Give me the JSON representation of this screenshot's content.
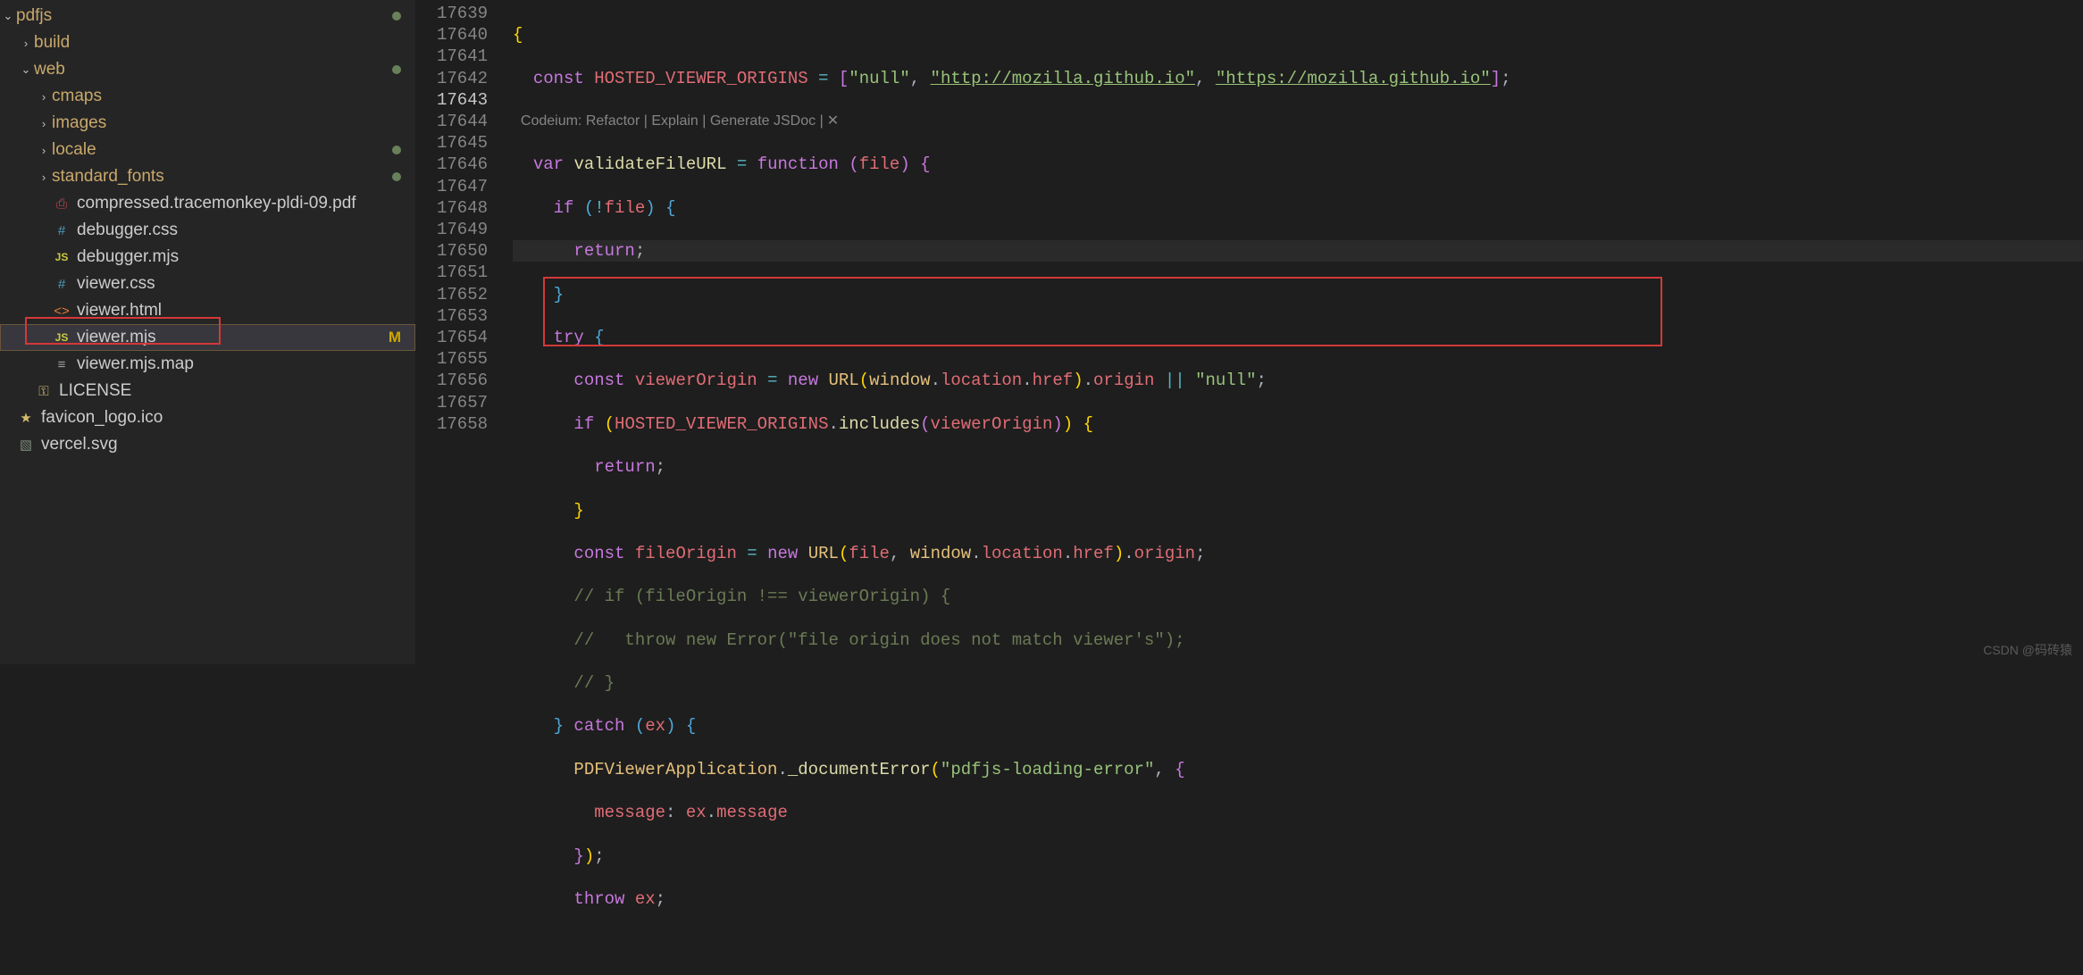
{
  "sidebar": {
    "root": "pdfjs",
    "items": [
      {
        "type": "folder",
        "name": "pdfjs",
        "depth": 0,
        "open": true,
        "dot": true
      },
      {
        "type": "folder",
        "name": "build",
        "depth": 1,
        "open": false
      },
      {
        "type": "folder",
        "name": "web",
        "depth": 1,
        "open": true,
        "dot": true
      },
      {
        "type": "folder",
        "name": "cmaps",
        "depth": 2,
        "open": false
      },
      {
        "type": "folder",
        "name": "images",
        "depth": 2,
        "open": false
      },
      {
        "type": "folder",
        "name": "locale",
        "depth": 2,
        "open": false,
        "dot": true
      },
      {
        "type": "folder",
        "name": "standard_fonts",
        "depth": 2,
        "open": false,
        "dot": true
      },
      {
        "type": "file",
        "name": "compressed.tracemonkey-pldi-09.pdf",
        "depth": 2,
        "icon": "pdf"
      },
      {
        "type": "file",
        "name": "debugger.css",
        "depth": 2,
        "icon": "css"
      },
      {
        "type": "file",
        "name": "debugger.mjs",
        "depth": 2,
        "icon": "js"
      },
      {
        "type": "file",
        "name": "viewer.css",
        "depth": 2,
        "icon": "css"
      },
      {
        "type": "file",
        "name": "viewer.html",
        "depth": 2,
        "icon": "html"
      },
      {
        "type": "file",
        "name": "viewer.mjs",
        "depth": 2,
        "icon": "js",
        "selected": true,
        "status": "M"
      },
      {
        "type": "file",
        "name": "viewer.mjs.map",
        "depth": 2,
        "icon": "map"
      },
      {
        "type": "file",
        "name": "LICENSE",
        "depth": 1,
        "icon": "license"
      },
      {
        "type": "file",
        "name": "favicon_logo.ico",
        "depth": 0,
        "icon": "star"
      },
      {
        "type": "file",
        "name": "vercel.svg",
        "depth": 0,
        "icon": "svg"
      }
    ]
  },
  "editor": {
    "line_start": 17639,
    "active_line": 17643,
    "codelens": "Codeium: Refactor | Explain | Generate JSDoc |",
    "codelens_close": "✕",
    "lines": {
      "l17639": "{",
      "l17640_pre": "  const ",
      "l17640_name": "HOSTED_VIEWER_ORIGINS",
      "l17640_eq": " = [",
      "l17640_s1": "\"null\"",
      "l17640_s2": "\"http://mozilla.github.io\"",
      "l17640_s3": "\"https://mozilla.github.io\"",
      "l17640_end": "];",
      "l17641_pre": "  var ",
      "l17641_fn": "validateFileURL",
      "l17641_mid": " = function (",
      "l17641_param": "file",
      "l17641_end": ") {",
      "l17642_a": "    if (!",
      "l17642_b": "file",
      "l17642_c": ") {",
      "l17643": "      return;",
      "l17644": "    }",
      "l17645": "    try {",
      "l17646_a": "      const ",
      "l17646_b": "viewerOrigin",
      "l17646_c": " = new ",
      "l17646_d": "URL",
      "l17646_e": "(",
      "l17646_f": "window",
      "l17646_g": ".location.href).origin || ",
      "l17646_h": "\"null\"",
      "l17646_i": ";",
      "l17647_a": "      if (",
      "l17647_b": "HOSTED_VIEWER_ORIGINS",
      "l17647_c": ".includes(",
      "l17647_d": "viewerOrigin",
      "l17647_e": ")) {",
      "l17648": "        return;",
      "l17649": "      }",
      "l17650_a": "      const ",
      "l17650_b": "fileOrigin",
      "l17650_c": " = new ",
      "l17650_d": "URL",
      "l17650_e": "(",
      "l17650_f": "file",
      "l17650_g": ", ",
      "l17650_h": "window",
      "l17650_i": ".location.href).origin;",
      "l17651": "      // if (fileOrigin !== viewerOrigin) {",
      "l17652": "      //   throw new Error(\"file origin does not match viewer's\");",
      "l17653": "      // }",
      "l17654_a": "    } catch (",
      "l17654_b": "ex",
      "l17654_c": ") {",
      "l17655_a": "      ",
      "l17655_b": "PDFViewerApplication",
      "l17655_c": ".",
      "l17655_d": "_documentError",
      "l17655_e": "(",
      "l17655_f": "\"pdfjs-loading-error\"",
      "l17655_g": ", {",
      "l17656_a": "        message: ",
      "l17656_b": "ex",
      "l17656_c": ".message",
      "l17657": "      });",
      "l17658_a": "      throw ",
      "l17658_b": "ex",
      "l17658_c": ";"
    }
  },
  "watermark": "CSDN @码砖猿"
}
